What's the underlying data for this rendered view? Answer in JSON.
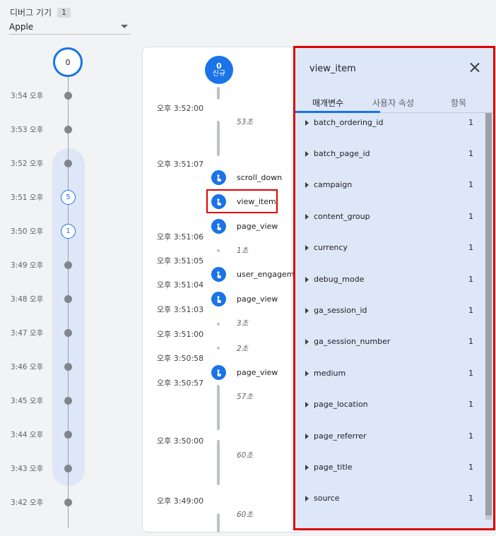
{
  "device": {
    "label": "디버그 기기",
    "count": "1",
    "selected": "Apple"
  },
  "minute_timeline": {
    "top_count": "0",
    "rows": [
      {
        "time": "3:54 오후",
        "badge": null
      },
      {
        "time": "3:53 오후",
        "badge": null
      },
      {
        "time": "3:52 오후",
        "badge": null
      },
      {
        "time": "3:51 오후",
        "badge": "5"
      },
      {
        "time": "3:50 오후",
        "badge": "1"
      },
      {
        "time": "3:49 오후",
        "badge": null
      },
      {
        "time": "3:48 오후",
        "badge": null
      },
      {
        "time": "3:47 오후",
        "badge": null
      },
      {
        "time": "3:46 오후",
        "badge": null
      },
      {
        "time": "3:45 오후",
        "badge": null
      },
      {
        "time": "3:44 오후",
        "badge": null
      },
      {
        "time": "3:43 오후",
        "badge": null
      },
      {
        "time": "3:42 오후",
        "badge": null
      }
    ]
  },
  "stream": {
    "new_user_count": "0",
    "new_user_label": "신규",
    "times": [
      "오후 3:52:00",
      "오후 3:51:07",
      "오후 3:51:06",
      "오후 3:51:05",
      "오후 3:51:04",
      "오후 3:51:03",
      "오후 3:51:00",
      "오후 3:50:58",
      "오후 3:50:57",
      "오후 3:50:00",
      "오후 3:49:00"
    ],
    "durations": [
      "53초",
      "1초",
      "3초",
      "2초",
      "57초",
      "60초",
      "60초"
    ],
    "events": [
      "scroll_down",
      "view_item",
      "page_view",
      "user_engagement",
      "page_view",
      "page_view"
    ]
  },
  "panel": {
    "title": "view_item",
    "tabs": [
      "매개변수",
      "사용자 속성",
      "항목"
    ],
    "active_tab": "매개변수",
    "params": [
      {
        "name": "batch_ordering_id",
        "count": "1"
      },
      {
        "name": "batch_page_id",
        "count": "1"
      },
      {
        "name": "campaign",
        "count": "1"
      },
      {
        "name": "content_group",
        "count": "1"
      },
      {
        "name": "currency",
        "count": "1"
      },
      {
        "name": "debug_mode",
        "count": "1"
      },
      {
        "name": "ga_session_id",
        "count": "1"
      },
      {
        "name": "ga_session_number",
        "count": "1"
      },
      {
        "name": "medium",
        "count": "1"
      },
      {
        "name": "page_location",
        "count": "1"
      },
      {
        "name": "page_referrer",
        "count": "1"
      },
      {
        "name": "page_title",
        "count": "1"
      },
      {
        "name": "source",
        "count": "1"
      }
    ]
  },
  "colors": {
    "accent": "#1a73e8",
    "highlight_border": "#e00000",
    "panel_bg": "#dde7f8"
  }
}
